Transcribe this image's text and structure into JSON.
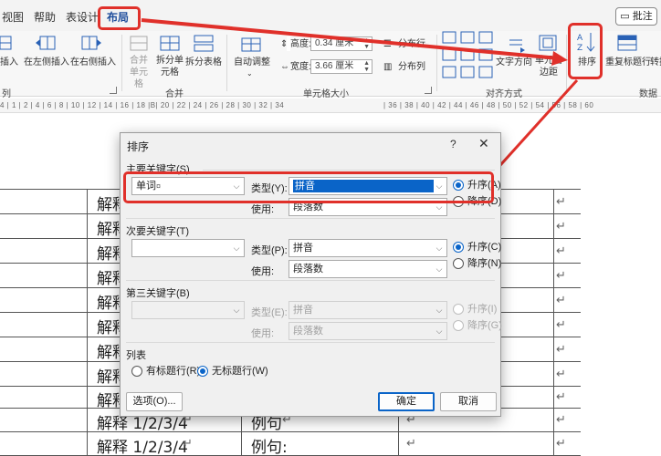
{
  "tabs": {
    "view": "视图",
    "help": "帮助",
    "table_design": "表设计",
    "layout": "布局",
    "comment": "批注"
  },
  "ribbon": {
    "insert_below": "插入",
    "insert_left": "在左侧插入",
    "insert_right": "在右侧插入",
    "merge_cells": "合并单元格",
    "split_cells": "拆分单元格",
    "split_table": "拆分表格",
    "autofit": "自动调整",
    "height_label": "高度:",
    "height_value": "0.34 厘米",
    "width_label": "宽度:",
    "width_value": "3.66 厘米",
    "distribute_rows": "分布行",
    "distribute_cols": "分布列",
    "text_direction": "文字方向",
    "cell_margins": "单元格边距",
    "sort": "排序",
    "repeat_header": "重复标题行",
    "convert": "转换",
    "groups": {
      "rows_cols": "列",
      "merge": "合并",
      "cell_size": "单元格大小",
      "alignment": "对齐方式",
      "data": "数据"
    }
  },
  "ruler": {
    "left_ticks": "4 | 1 | 2 | 4 | 6 | 8 | 10 | 12 | 14 | 16 | 18 |B| 20 | 22 | 24 | 26 | 28 | 30 | 32 | 34",
    "right_ticks": "| 36 | 38 | 40 | 42 | 44 | 46 | 48 | 50 | 52 | 54 | 56 | 58 | 60"
  },
  "document": {
    "explain": "解释",
    "explain_full": "解释 1/2/3/4",
    "example": "例句:",
    "example_partial": "例句"
  },
  "dialog": {
    "title": "排序",
    "help": "?",
    "close": "✕",
    "primary_section": "主要关键字(S)",
    "primary_key": "单词",
    "secondary_section": "次要关键字(T)",
    "tertiary_section": "第三关键字(B)",
    "type_label": "类型(Y):",
    "type_label_p": "类型(P):",
    "type_label_e": "类型(E):",
    "use_label": "使用:",
    "type_value": "拼音",
    "use_value": "段落数",
    "ascending_a": "升序(A)",
    "descending_d": "降序(D)",
    "ascending_c": "升序(C)",
    "descending_n": "降序(N)",
    "ascending_i": "升序(I)",
    "descending_g": "降序(G)",
    "list_section": "列表",
    "has_header": "有标题行(R)",
    "no_header": "无标题行(W)",
    "options": "选项(O)...",
    "ok": "确定",
    "cancel": "取消"
  }
}
